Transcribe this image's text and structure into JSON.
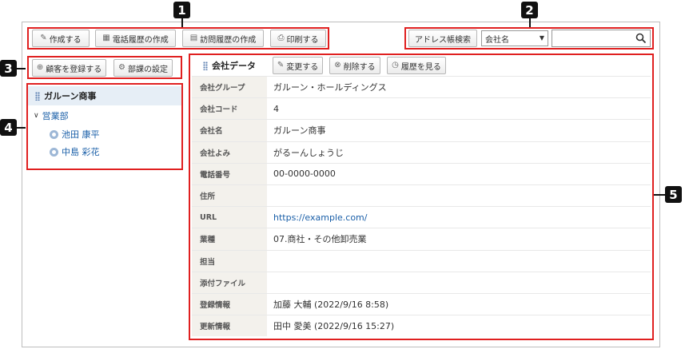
{
  "toolbar": {
    "create": "作成する",
    "phone_history": "電話履歴の作成",
    "visit_history": "訪問履歴の作成",
    "print": "印刷する"
  },
  "address_search": {
    "button": "アドレス帳検索",
    "select_value": "会社名",
    "query": ""
  },
  "left_actions": {
    "register_customer": "顧客を登録する",
    "department_settings": "部課の設定"
  },
  "tree": {
    "company": "ガルーン商事",
    "department": "営業部",
    "members": [
      "池田 康平",
      "中島 彩花"
    ]
  },
  "company_panel": {
    "title": "会社データ",
    "edit": "変更する",
    "delete": "削除する",
    "history": "履歴を見る"
  },
  "fields": [
    {
      "label": "会社グループ",
      "value": "ガルーン・ホールディングス"
    },
    {
      "label": "会社コード",
      "value": "4"
    },
    {
      "label": "会社名",
      "value": "ガルーン商事"
    },
    {
      "label": "会社よみ",
      "value": "がるーんしょうじ"
    },
    {
      "label": "電話番号",
      "value": "00-0000-0000"
    },
    {
      "label": "住所",
      "value": ""
    },
    {
      "label": "URL",
      "value": "https://example.com/"
    },
    {
      "label": "業種",
      "value": "07.商社・その他卸売業"
    },
    {
      "label": "担当",
      "value": ""
    },
    {
      "label": "添付ファイル",
      "value": ""
    },
    {
      "label": "登録情報",
      "value": "加藤 大輔 (2022/9/16 8:58)"
    },
    {
      "label": "更新情報",
      "value": "田中 愛美 (2022/9/16 15:27)"
    }
  ],
  "callouts": [
    "1",
    "2",
    "3",
    "4",
    "5"
  ],
  "colors": {
    "highlight": "#e02020",
    "link": "#1a5fa8",
    "label_bg": "#f3f1ec",
    "tree_head_bg": "#e6eef6"
  }
}
